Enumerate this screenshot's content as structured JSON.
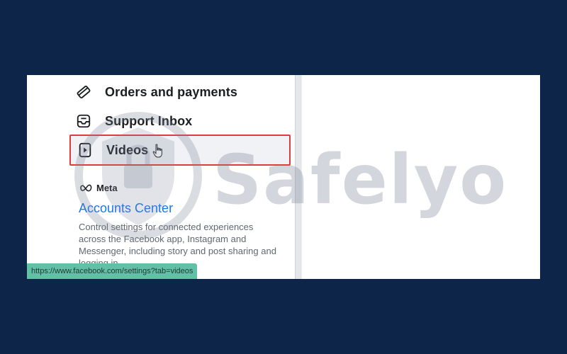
{
  "menu": {
    "items": [
      {
        "label": "Orders and payments",
        "icon": "credit-card-icon"
      },
      {
        "label": "Support Inbox",
        "icon": "inbox-icon"
      },
      {
        "label": "Videos",
        "icon": "video-icon"
      }
    ]
  },
  "meta": {
    "logo_text": "Meta",
    "accounts_center": "Accounts Center",
    "description": "Control settings for connected experiences across the Facebook app, Instagram and Messenger, including story and post sharing and logging in."
  },
  "status_bar": {
    "url": "https://www.facebook.com/settings?tab=videos"
  },
  "watermark": {
    "text": "Safelyo"
  },
  "colors": {
    "background": "#0c2548",
    "highlight_border": "#e03c3c",
    "link": "#1877f2",
    "status_bar": "#62c0a6"
  }
}
